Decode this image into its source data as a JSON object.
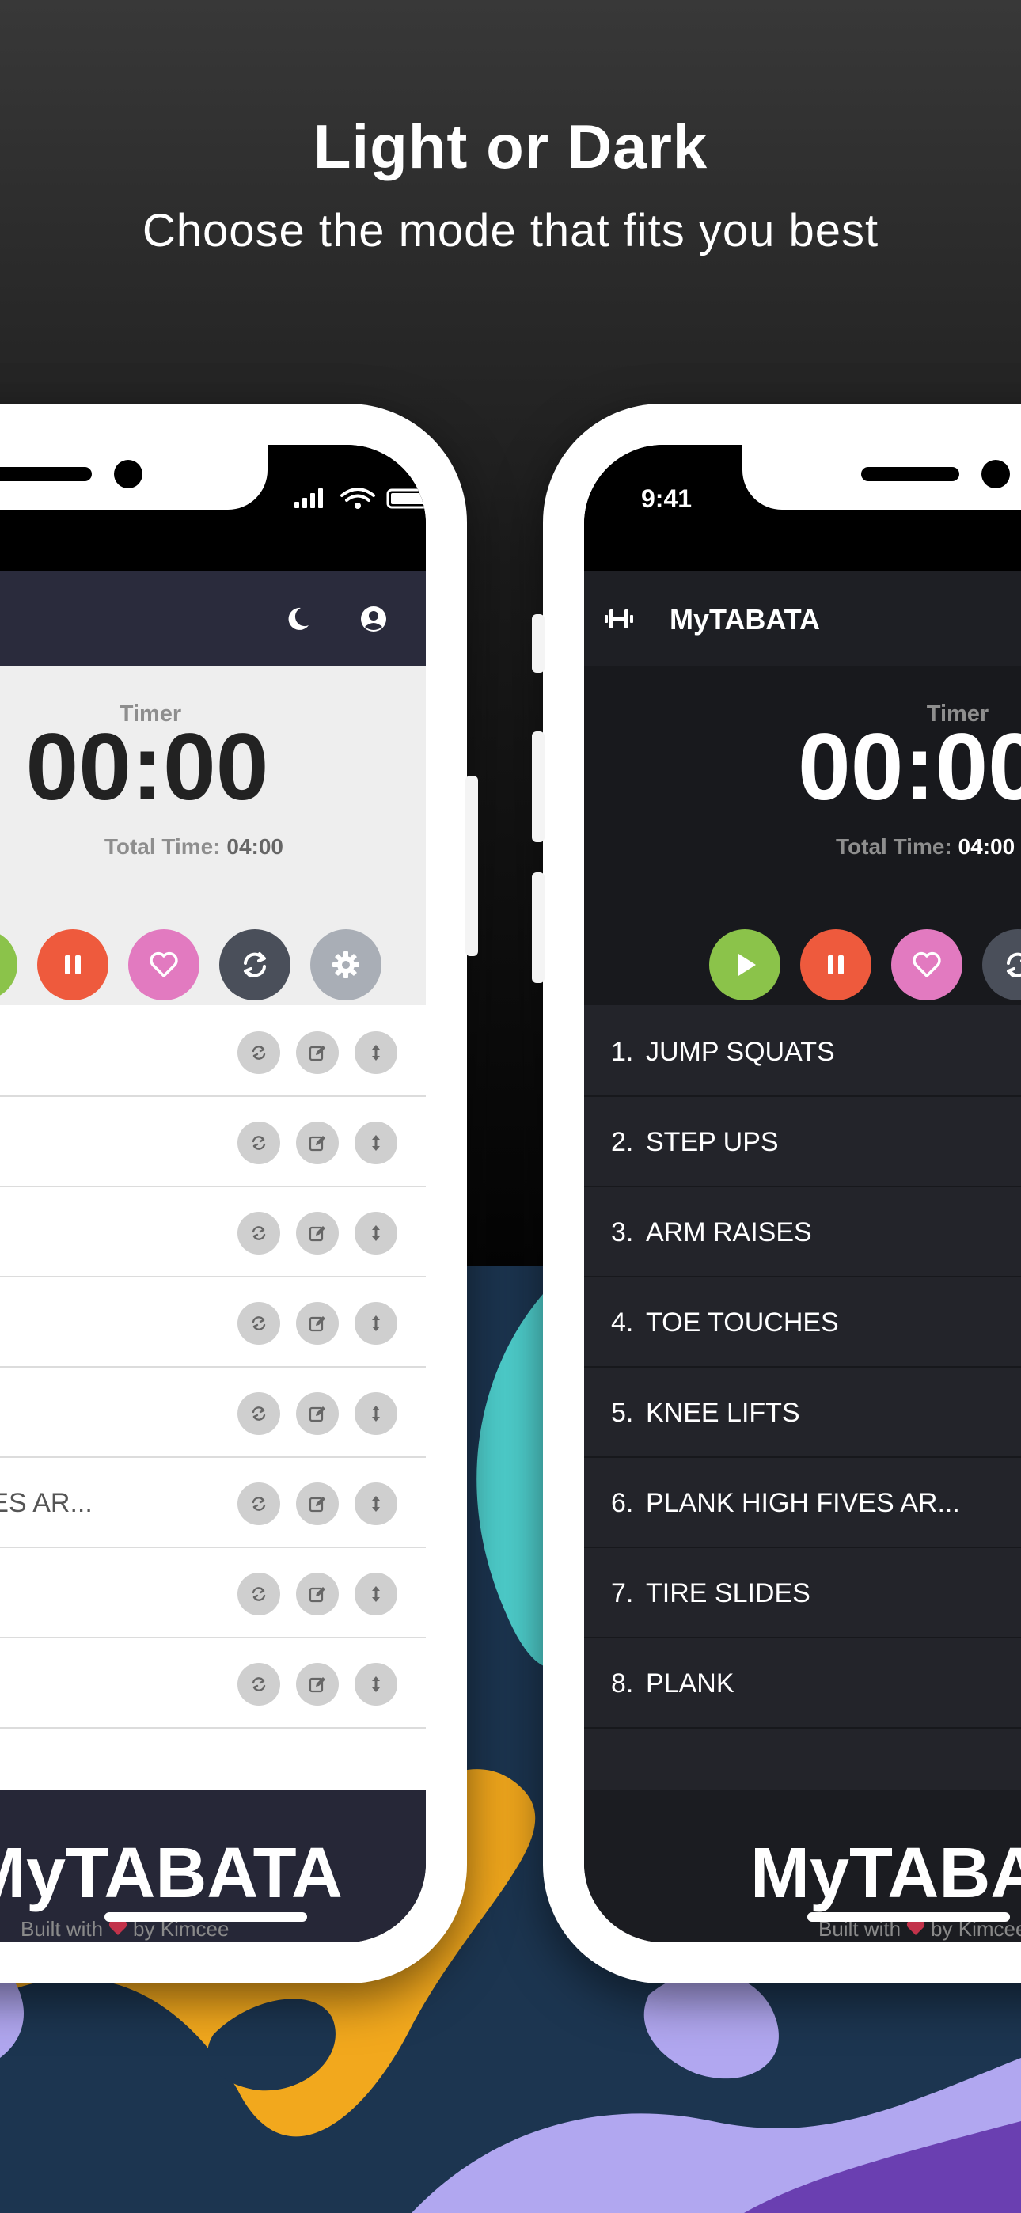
{
  "hero": {
    "title": "Light or Dark",
    "subtitle": "Choose the mode that fits you best"
  },
  "app": {
    "name": "MyTABATA",
    "status_time": "9:41",
    "timer_label": "Timer",
    "timer_value": "00:00",
    "total_time_label": "Total Time:",
    "total_time_value": "04:00",
    "footer_brand": "MyTABATA",
    "credit_prefix": "Built with",
    "credit_suffix": "by Kimcee"
  },
  "exercises": [
    {
      "num": "1.",
      "name": "JUMP SQUATS"
    },
    {
      "num": "2.",
      "name": "STEP UPS"
    },
    {
      "num": "3.",
      "name": "ARM RAISES"
    },
    {
      "num": "4.",
      "name": "TOE TOUCHES"
    },
    {
      "num": "5.",
      "name": "KNEE LIFTS"
    },
    {
      "num": "6.",
      "name": "PLANK HIGH FIVES AR..."
    },
    {
      "num": "7.",
      "name": "TIRE SLIDES"
    },
    {
      "num": "8.",
      "name": "PLANK"
    }
  ],
  "colors": {
    "play": "#8bc34a",
    "pause": "#ee5a3d",
    "favorite": "#e27ac0",
    "reset": "#4a4f5a",
    "settings": "#a9aeb6",
    "heart": "#c2324a",
    "blob_orange": "#f2a81d",
    "blob_teal": "#4fd1cf",
    "blob_lavender": "#b1a7f0",
    "blob_purple": "#6a3fb1"
  },
  "icons": {
    "brand": "dumbbell-icon",
    "theme_toggle": "moon-icon",
    "account": "account-circle-icon",
    "play": "play-icon",
    "pause": "pause-icon",
    "favorite": "heart-icon",
    "reset": "refresh-icon",
    "settings": "gear-icon",
    "row_actions": [
      "swap-icon",
      "edit-icon",
      "reorder-icon"
    ]
  },
  "modes": [
    "light",
    "dark"
  ]
}
